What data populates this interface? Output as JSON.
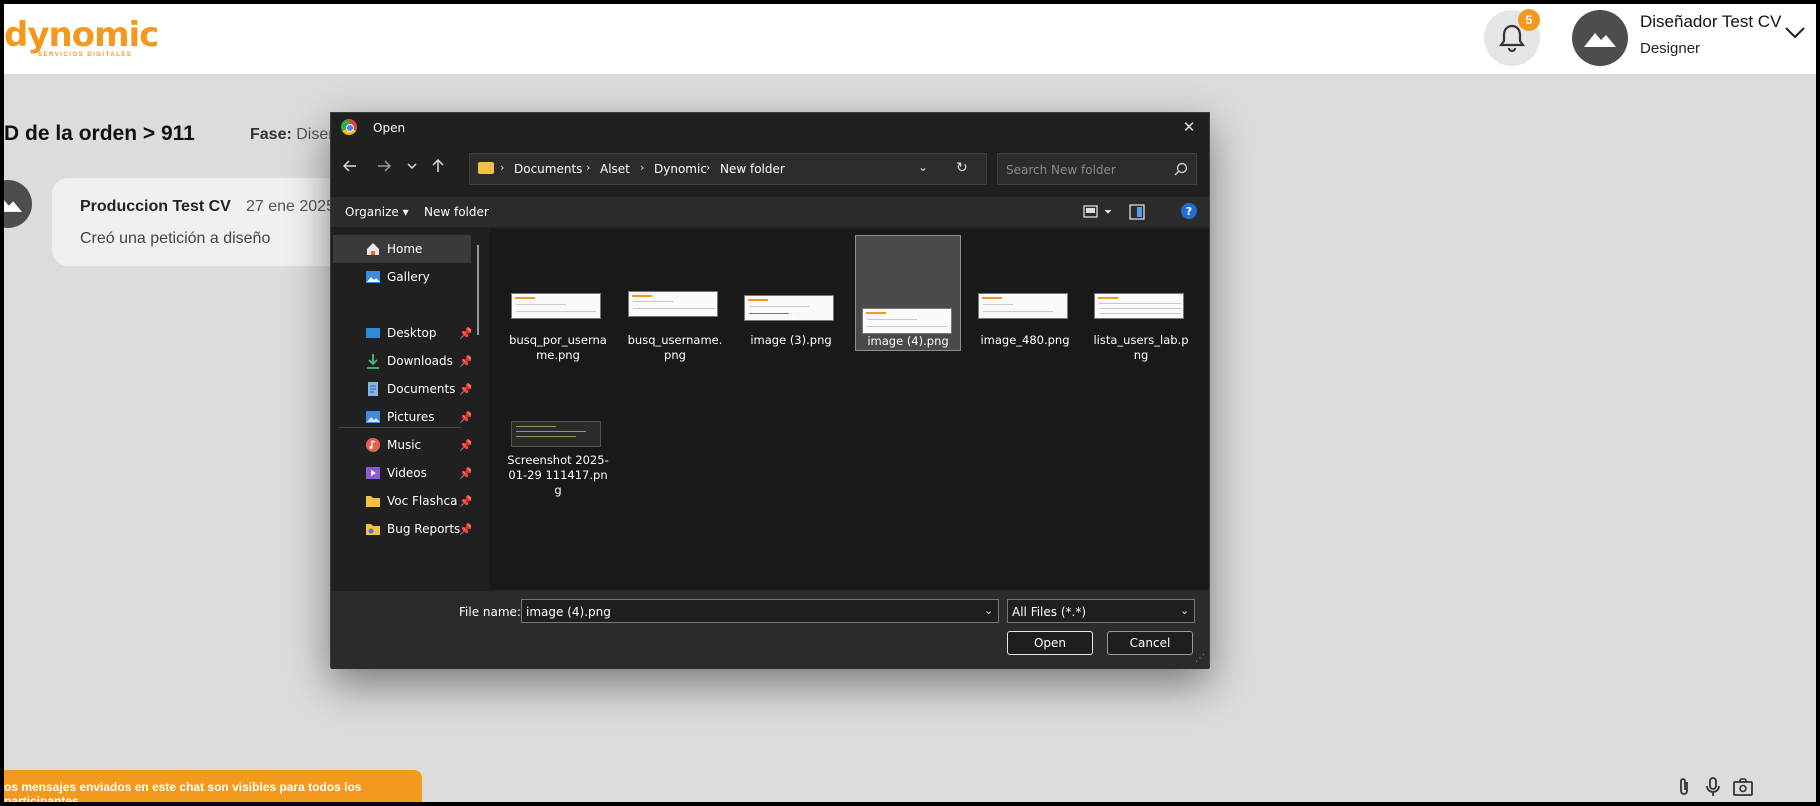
{
  "app": {
    "logo_text": "dynomic",
    "logo_subtext": "SERVICIOS DIGITALES",
    "notifications_count": "5",
    "user_name": "Diseñador Test CV",
    "user_role": "Designer",
    "accent_color": "#f39a1e"
  },
  "page": {
    "order_title": "D de la orden > 911",
    "phase_label": "Fase:",
    "phase_value": "Diseñ",
    "message": {
      "author": "Produccion Test CV",
      "date": "27 ene 2025",
      "text": "Creó una petición a diseño"
    },
    "notice": "os mensajes enviados en este chat son visibles para todos los participantes.",
    "tools": [
      "paperclip-icon",
      "microphone-icon",
      "camera-folder-icon"
    ]
  },
  "dialog": {
    "title": "Open",
    "breadcrumb": [
      "Documents",
      "Alset",
      "Dynomic",
      "New folder"
    ],
    "search_placeholder": "Search New folder",
    "organize_label": "Organize ▾",
    "new_folder_label": "New folder",
    "nav_items": [
      {
        "label": "Home",
        "icon": "home-icon",
        "pinned": false,
        "selected": true
      },
      {
        "label": "Gallery",
        "icon": "gallery-icon",
        "pinned": false,
        "selected": false
      },
      {
        "label": "Desktop",
        "icon": "desktop-icon",
        "pinned": true,
        "selected": false
      },
      {
        "label": "Downloads",
        "icon": "download-icon",
        "pinned": true,
        "selected": false
      },
      {
        "label": "Documents",
        "icon": "documents-icon",
        "pinned": true,
        "selected": false
      },
      {
        "label": "Pictures",
        "icon": "pictures-icon",
        "pinned": true,
        "selected": false
      },
      {
        "label": "Music",
        "icon": "music-icon",
        "pinned": true,
        "selected": false
      },
      {
        "label": "Videos",
        "icon": "videos-icon",
        "pinned": true,
        "selected": false
      },
      {
        "label": "Voc Flashcards",
        "icon": "folder-icon",
        "pinned": true,
        "selected": false
      },
      {
        "label": "Bug Reports",
        "icon": "bug-report-icon",
        "pinned": true,
        "selected": false
      }
    ],
    "files": [
      {
        "name": "busq_por_username.png",
        "selected": false,
        "dark": false
      },
      {
        "name": "busq_username.png",
        "selected": false,
        "dark": false
      },
      {
        "name": "image (3).png",
        "selected": false,
        "dark": false
      },
      {
        "name": "image (4).png",
        "selected": true,
        "dark": false
      },
      {
        "name": "image_480.png",
        "selected": false,
        "dark": false
      },
      {
        "name": "lista_users_lab.png",
        "selected": false,
        "dark": false
      },
      {
        "name": "Screenshot 2025-01-29 111417.png",
        "selected": false,
        "dark": true
      }
    ],
    "file_name_label": "File name:",
    "file_name_value": "image (4).png",
    "file_type_value": "All Files (*.*)",
    "open_label": "Open",
    "cancel_label": "Cancel"
  }
}
